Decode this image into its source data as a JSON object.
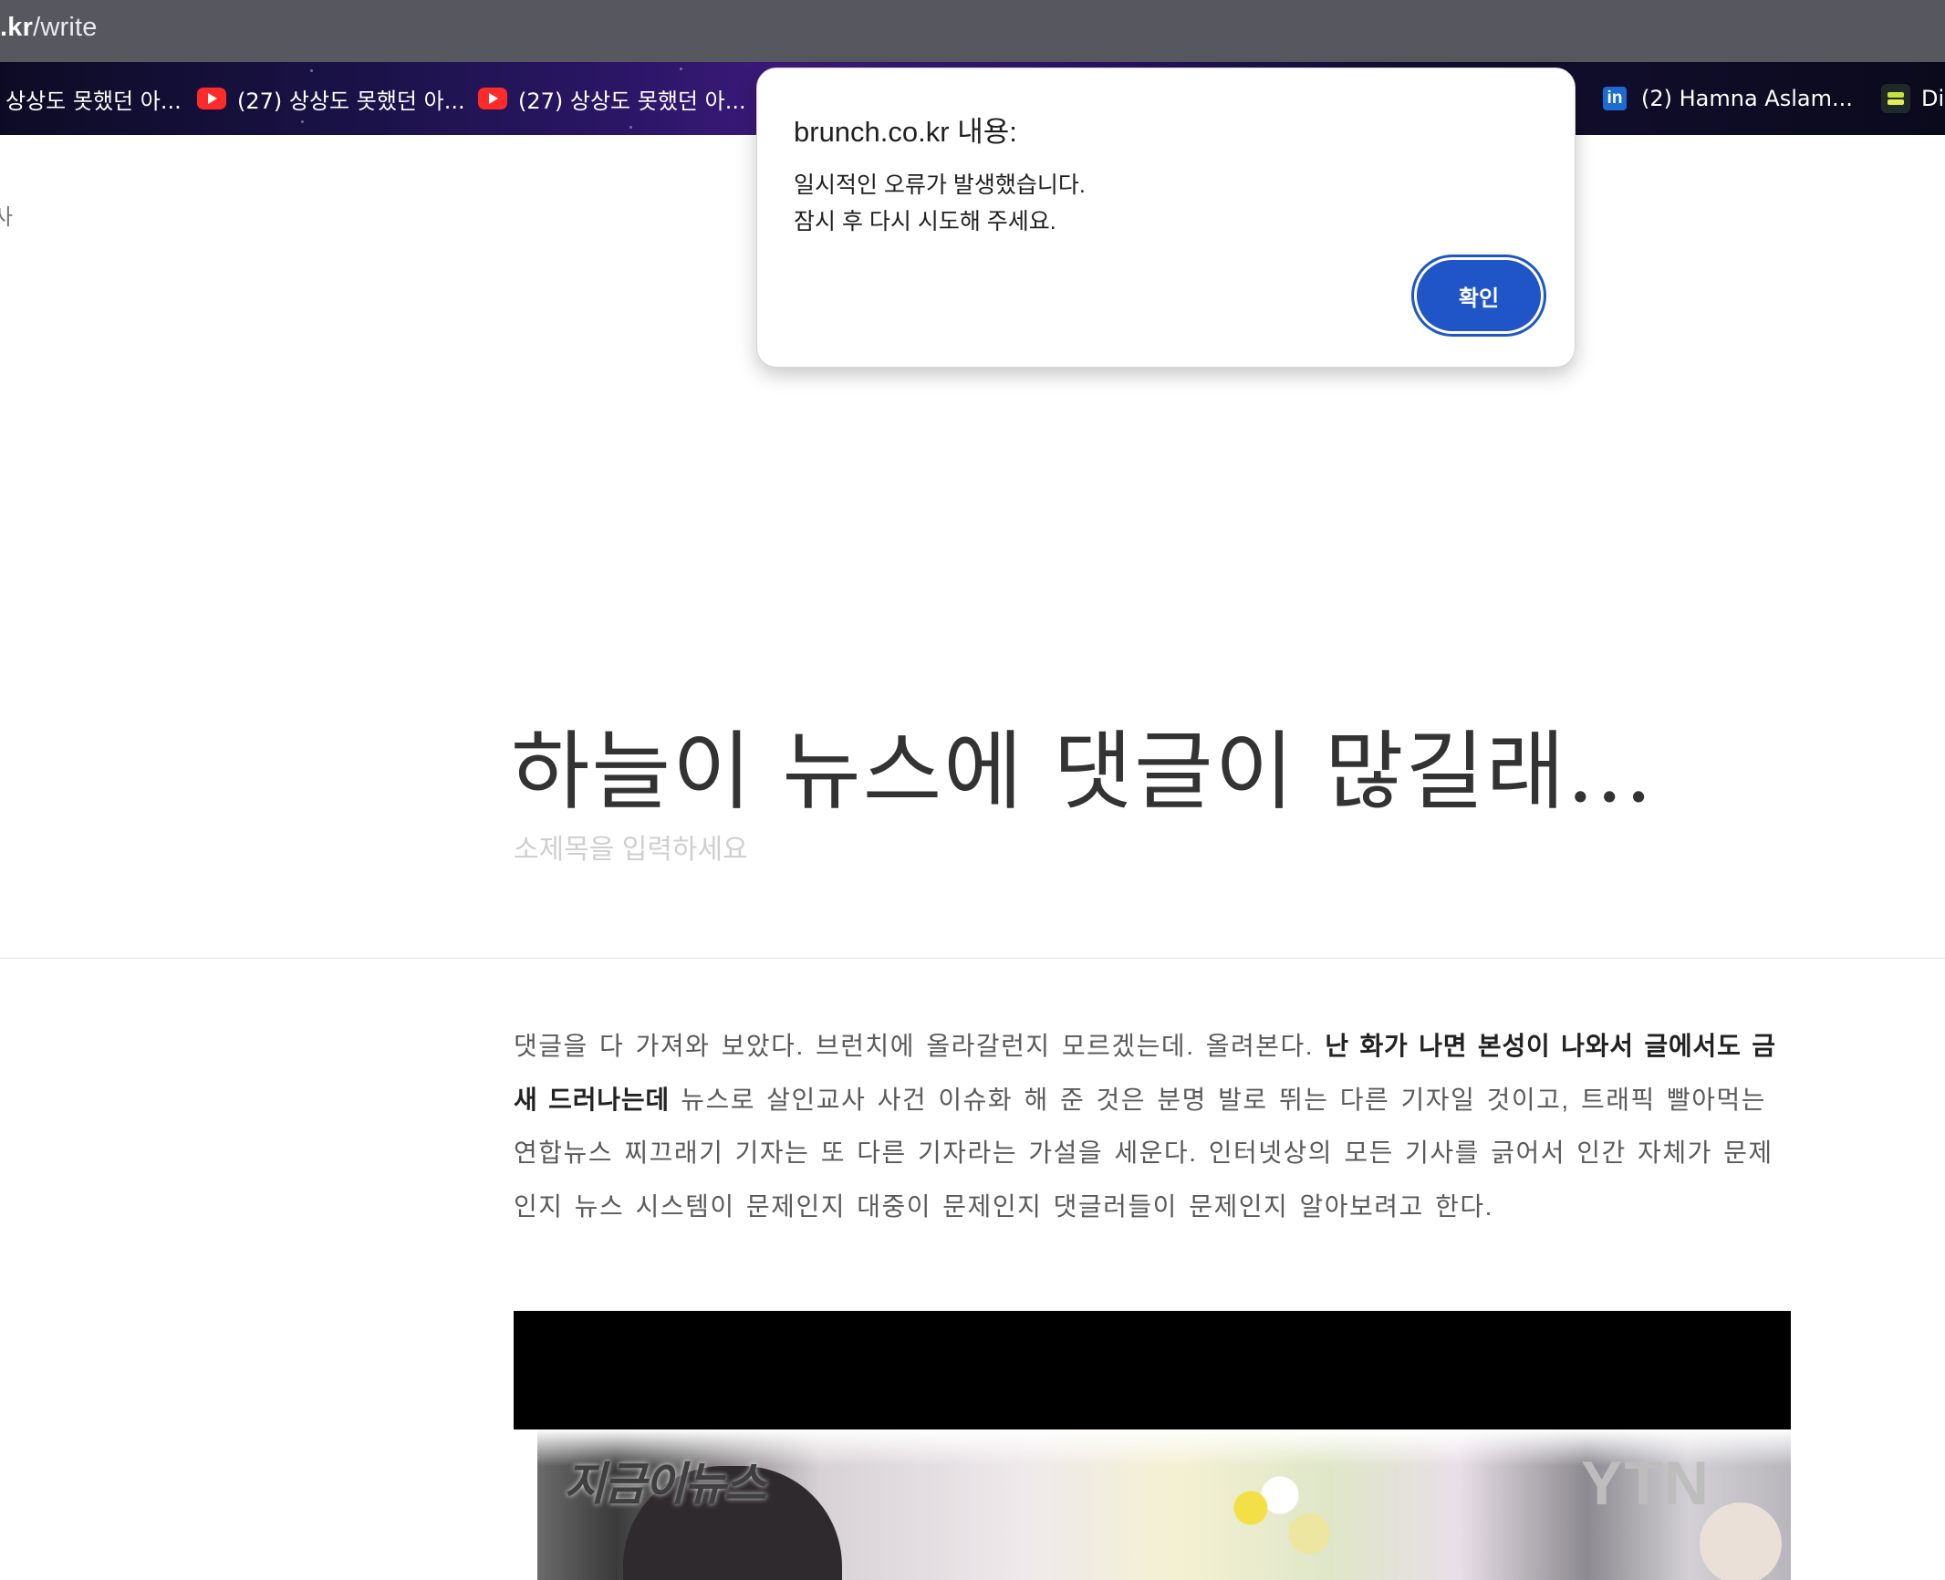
{
  "browser": {
    "address_prefix": ".kr",
    "address_path": "/write"
  },
  "bookmarks": [
    {
      "label": "상상도 못했던 아...",
      "icon": "youtube-icon"
    },
    {
      "label": "(27) 상상도 못했던 아...",
      "icon": "youtube-icon"
    },
    {
      "label": "(27) 상상도 못했던 아...",
      "icon": "youtube-icon"
    },
    {
      "label": "(2) Hamna Aslam...",
      "icon": "linkedin-icon"
    },
    {
      "label": "Di",
      "icon": "stack-icon"
    }
  ],
  "page": {
    "side_fragment": "사",
    "title": "하늘이 뉴스에 댓글이 많길래...",
    "subtitle_placeholder": "소제목을 입력하세요",
    "body": {
      "part1": "댓글을 다 가져와 보았다. 브런치에 올라갈런지 모르겠는데. 올려본다. ",
      "bold": "난 화가 나면 본성이 나와서 글에서도 금새 드러나는데",
      "part2": " 뉴스로 살인교사 사건 이슈화 해 준 것은 분명 발로 뛰는 다른 기자일 것이고, 트래픽 빨아먹는 연합뉴스 찌끄래기 기자는 또 다른 기자라는 가설을 세운다. 인터넷상의 모든 기사를 긁어서 인간 자체가 문제인지 뉴스 시스템이 문제인지 대중이 문제인지 댓글러들이 문제인지 알아보려고 한다."
    },
    "media": {
      "logo_text": "지금이뉴스",
      "brand_text": "YTN"
    }
  },
  "dialog": {
    "title": "brunch.co.kr 내용:",
    "message_line1": "일시적인 오류가 발생했습니다.",
    "message_line2": "잠시 후 다시 시도해 주세요.",
    "confirm_label": "확인"
  },
  "colors": {
    "address_bar_bg": "#57575f",
    "dialog_button": "#1f55c7",
    "youtube_red": "#ff2a2a",
    "linkedin_blue": "#1b6bd0"
  }
}
